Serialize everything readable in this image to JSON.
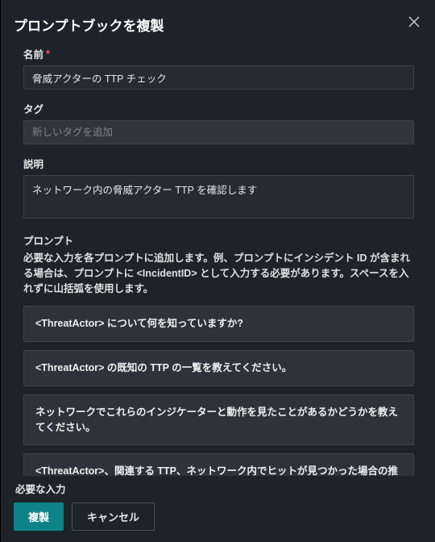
{
  "dialog": {
    "title": "プロンプトブックを複製"
  },
  "fields": {
    "name": {
      "label": "名前",
      "required": "*",
      "value": "脅威アクターの TTP チェック"
    },
    "tag": {
      "label": "タグ",
      "placeholder": "新しいタグを追加"
    },
    "description": {
      "label": "説明",
      "value": "ネットワーク内の脅威アクター TTP を確認します"
    }
  },
  "prompts": {
    "label": "プロンプト",
    "hint": "必要な入力を各プロンプトに追加します。例、プロンプトにインシデント ID が含まれる場合は、プロンプトに <IncidentID> として入力する必要があります。スペースを入れずに山括弧を使用します。",
    "items": [
      "<ThreatActor> について何を知っていますか?",
      "<ThreatActor> の既知の TTP の一覧を教えてください。",
      "ネットワークでこれらのインジケーターと動作を見たことがあるかどうかを教えてください。",
      "<ThreatActor>、関連する TTP、ネットワーク内でヒットが見つかった場合の推奨事項の概要を教えてください。"
    ]
  },
  "footer": {
    "inputs_label": "必要な入力",
    "primary": "複製",
    "secondary": "キャンセル"
  }
}
